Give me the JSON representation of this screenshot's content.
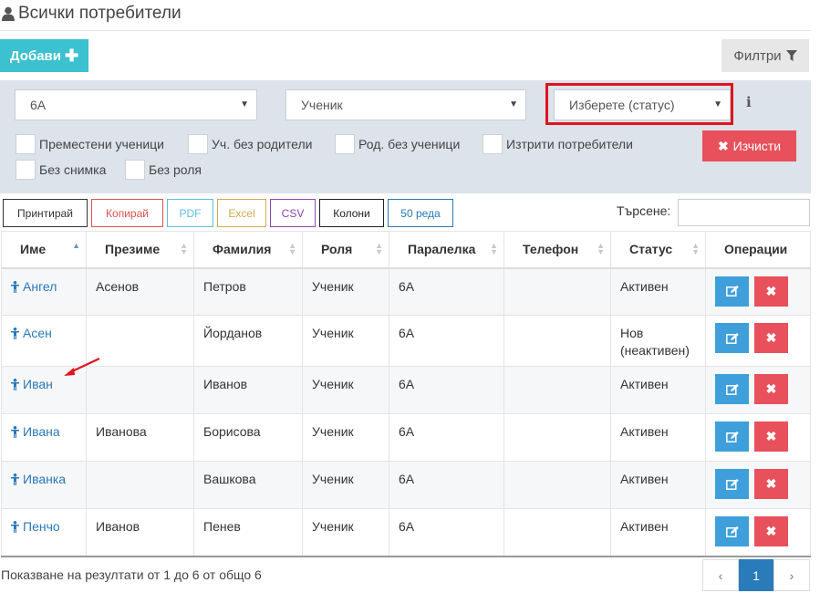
{
  "page": {
    "title": "Всички потребители"
  },
  "toolbar": {
    "add_label": "Добави",
    "filters_label": "Филтри"
  },
  "filters": {
    "class_select": "6А",
    "role_select": "Ученик",
    "status_select": "Изберете (статус)",
    "info_icon": "i",
    "checkboxes": [
      "Преместени ученици",
      "Уч. без родители",
      "Род. без ученици",
      "Изтрити потребители",
      "Без снимка",
      "Без роля"
    ],
    "clear_label": "Изчисти"
  },
  "export_buttons": [
    {
      "label": "Принтирай",
      "color": "#333333"
    },
    {
      "label": "Копирай",
      "color": "#d9534f"
    },
    {
      "label": "PDF",
      "color": "#5bc0de"
    },
    {
      "label": "Excel",
      "color": "#d4a84b"
    },
    {
      "label": "CSV",
      "color": "#8e44ad"
    },
    {
      "label": "Колони",
      "color": "#222222"
    },
    {
      "label": "50 реда",
      "color": "#2a78b8"
    }
  ],
  "search": {
    "label": "Търсене:",
    "value": ""
  },
  "table": {
    "columns": [
      "Име",
      "Презиме",
      "Фамилия",
      "Роля",
      "Паралелка",
      "Телефон",
      "Статус",
      "Операции"
    ],
    "rows": [
      {
        "first": "Ангел",
        "middle": "Асенов",
        "last": "Петров",
        "role": "Ученик",
        "class": "6А",
        "phone": "",
        "status": "Активен"
      },
      {
        "first": "Асен",
        "middle": "",
        "last": "Йорданов",
        "role": "Ученик",
        "class": "6А",
        "phone": "",
        "status": "Нов (неактивен)"
      },
      {
        "first": "Иван",
        "middle": "",
        "last": "Иванов",
        "role": "Ученик",
        "class": "6А",
        "phone": "",
        "status": "Активен"
      },
      {
        "first": "Ивана",
        "middle": "Иванова",
        "last": "Борисова",
        "role": "Ученик",
        "class": "6А",
        "phone": "",
        "status": "Активен"
      },
      {
        "first": "Иванка",
        "middle": "",
        "last": "Вашкова",
        "role": "Ученик",
        "class": "6А",
        "phone": "",
        "status": "Активен"
      },
      {
        "first": "Пенчо",
        "middle": "Иванов",
        "last": "Пенев",
        "role": "Ученик",
        "class": "6А",
        "phone": "",
        "status": "Активен"
      }
    ]
  },
  "footer": {
    "info": "Показване на резултати от 1 до 6 от общо 6",
    "pagination": {
      "prev": "‹",
      "current": "1",
      "next": "›"
    }
  },
  "colors": {
    "accent_add": "#3bc1cf",
    "danger": "#e8505b",
    "primary": "#2a7bb9",
    "highlight": "#e0141e"
  }
}
